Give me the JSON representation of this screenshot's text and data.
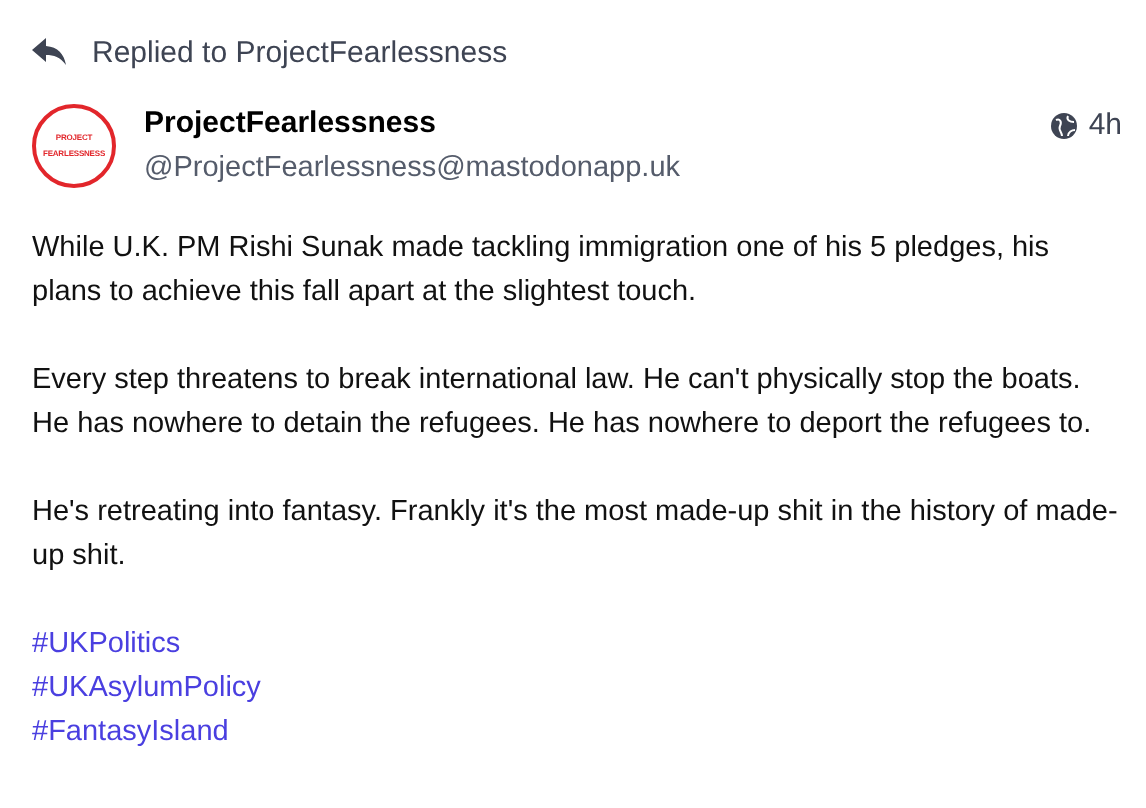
{
  "reply_banner": {
    "text": "Replied to ProjectFearlessness"
  },
  "post": {
    "avatar": {
      "line_1": "PROJECT",
      "line_2": "FEARLESSNESS"
    },
    "display_name": "ProjectFearlessness",
    "handle": "@ProjectFearlessness@mastodonapp.uk",
    "time": "4h",
    "paragraphs": [
      "While U.K. PM Rishi Sunak made tackling immigration one of his 5 pledges, his plans to achieve this fall apart at the slightest touch.",
      "Every step threatens to break international law. He can't physically stop the boats. He has nowhere to detain the refugees. He has nowhere to deport the refugees to.",
      "He's retreating into fantasy. Frankly it's the most made-up shit in the history of made-up shit."
    ],
    "hashtags": [
      "#UKPolitics",
      "#UKAsylumPolicy",
      "#FantasyIsland"
    ]
  }
}
